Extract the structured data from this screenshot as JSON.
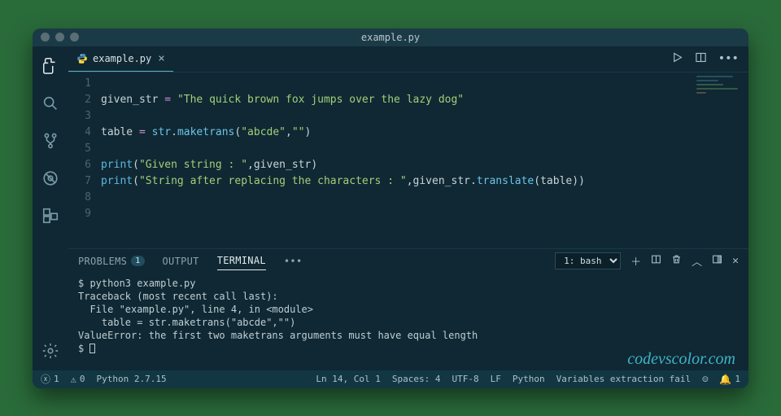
{
  "title": "example.py",
  "tab": {
    "label": "example.py"
  },
  "code": {
    "lines": [
      "1",
      "2",
      "3",
      "4",
      "5",
      "6",
      "7",
      "8",
      "9"
    ],
    "l2_var": "given_str",
    "l2_op": " = ",
    "l2_str": "\"The quick brown fox jumps over the lazy dog\"",
    "l4_var": "table",
    "l4_op": " = ",
    "l4_obj": "str",
    "l4_dot": ".",
    "l4_meth": "maketrans",
    "l4_args_open": "(",
    "l4_arg1": "\"abcde\"",
    "l4_comma": ",",
    "l4_arg2": "\"\"",
    "l4_args_close": ")",
    "l6_func": "print",
    "l6_open": "(",
    "l6_str": "\"Given string : \"",
    "l6_comma": ",",
    "l6_var": "given_str",
    "l6_close": ")",
    "l7_func": "print",
    "l7_open": "(",
    "l7_str": "\"String after replacing the characters : \"",
    "l7_comma": ",",
    "l7_var": "given_str",
    "l7_dot": ".",
    "l7_meth": "translate",
    "l7_open2": "(",
    "l7_arg": "table",
    "l7_close2": ")",
    "l7_close": ")"
  },
  "panel": {
    "tab_problems": "PROBLEMS",
    "problems_count": "1",
    "tab_output": "OUTPUT",
    "tab_terminal": "TERMINAL",
    "more": "•••",
    "shell_label": "1: bash"
  },
  "terminal": {
    "line1": "$ python3 example.py",
    "line2": "Traceback (most recent call last):",
    "line3": "  File \"example.py\", line 4, in <module>",
    "line4": "    table = str.maketrans(\"abcde\",\"\")",
    "line5": "ValueError: the first two maketrans arguments must have equal length",
    "prompt": "$ "
  },
  "watermark": "codevscolor.com",
  "status": {
    "errors": "1",
    "warnings": "0",
    "python": "Python 2.7.15",
    "cursor": "Ln 14, Col 1",
    "spaces": "Spaces: 4",
    "encoding": "UTF-8",
    "eol": "LF",
    "lang": "Python",
    "extra": "Variables extraction fail",
    "bell": "1"
  }
}
